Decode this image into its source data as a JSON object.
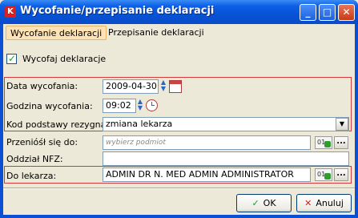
{
  "window": {
    "title": "Wycofanie/przepisanie deklaracji",
    "app_icon_text": "K",
    "minimize_glyph": "_",
    "maximize_glyph": "□",
    "close_glyph": "✕"
  },
  "tabs": [
    {
      "label": "Wycofanie deklaracji",
      "active": true
    },
    {
      "label": "Przepisanie deklaracji",
      "active": false
    }
  ],
  "withdraw": {
    "checkbox_label": "Wycofaj deklaracje",
    "checked": true,
    "check_glyph": "✓"
  },
  "form": {
    "date_label": "Data wycofania:",
    "date_value": "2009-04-30",
    "time_label": "Godzina wycofania:",
    "time_value": "09:02",
    "reason_label": "Kod podstawy rezygnacji:",
    "reason_value": "zmiana lekarza",
    "move_label": "Przenióśł się do:",
    "move_placeholder": "wybierz podmiot",
    "nfz_label": "Oddział NFZ:",
    "nfz_value": "",
    "doctor_label": "Do lekarza:",
    "doctor_value": "ADMIN DR N. MED ADMIN ADMINISTRATOR"
  },
  "icons": {
    "spin_up": "▲",
    "spin_down": "▼",
    "dropdown_arrow": "▼",
    "picker_text": "01",
    "dots": "..."
  },
  "buttons": {
    "ok_label": "OK",
    "ok_glyph": "✓",
    "cancel_label": "Anuluj",
    "cancel_glyph": "✕"
  }
}
